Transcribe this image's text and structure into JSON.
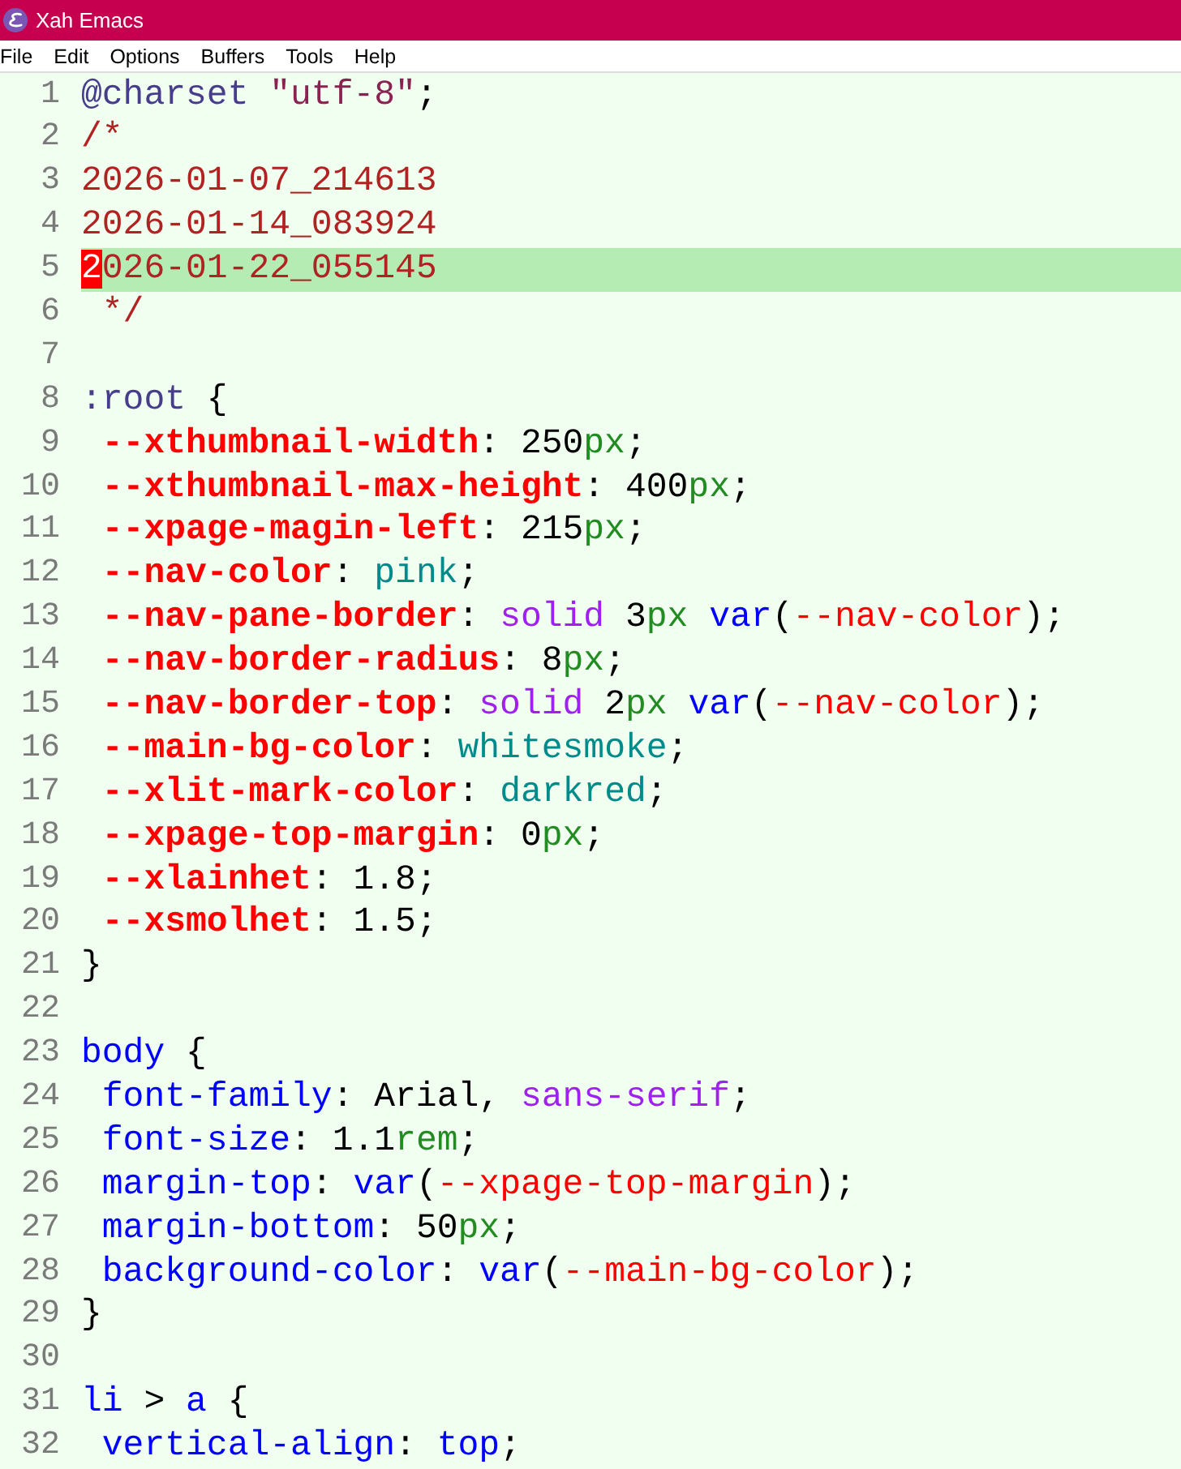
{
  "window": {
    "title": "Xah Emacs"
  },
  "menu_bar": [
    "File",
    "Edit",
    "Options",
    "Buffers",
    "Tools",
    "Help"
  ],
  "editor": {
    "lines": [
      {
        "number": "1",
        "current": false,
        "segments": [
          {
            "text": "@charset",
            "kind": "builtin"
          },
          {
            "text": " \"utf-8\"",
            "kind": "string"
          },
          {
            "text": ";",
            "kind": "plain"
          }
        ]
      },
      {
        "number": "2",
        "current": false,
        "segments": [
          {
            "text": "/*",
            "kind": "comment"
          }
        ]
      },
      {
        "number": "3",
        "current": false,
        "segments": [
          {
            "text": "2026-01-07_214613",
            "kind": "comment"
          }
        ]
      },
      {
        "number": "4",
        "current": false,
        "segments": [
          {
            "text": "2026-01-14_083924",
            "kind": "comment"
          }
        ]
      },
      {
        "number": "5",
        "current": true,
        "segments": [
          {
            "text": "2",
            "kind": "cursor"
          },
          {
            "text": "026-01-22_055145",
            "kind": "comment"
          }
        ]
      },
      {
        "number": "6",
        "current": false,
        "segments": [
          {
            "text": " */",
            "kind": "comment"
          }
        ]
      },
      {
        "number": "7",
        "current": false
      },
      {
        "number": "8",
        "current": false,
        "segments": [
          {
            "text": ":root",
            "kind": "builtin"
          },
          {
            "text": " {",
            "kind": "plain"
          }
        ]
      },
      {
        "number": "9",
        "current": false,
        "segments": [
          {
            "text": " --xthumbnail-width",
            "kind": "custom-property"
          },
          {
            "text": ": 250",
            "kind": "plain"
          },
          {
            "text": "px",
            "kind": "unit"
          },
          {
            "text": ";",
            "kind": "plain"
          }
        ]
      },
      {
        "number": "10",
        "current": false,
        "segments": [
          {
            "text": " --xthumbnail-max-height",
            "kind": "custom-property"
          },
          {
            "text": ": 400",
            "kind": "plain"
          },
          {
            "text": "px",
            "kind": "unit"
          },
          {
            "text": ";",
            "kind": "plain"
          }
        ]
      },
      {
        "number": "11",
        "current": false,
        "segments": [
          {
            "text": " --xpage-magin-left",
            "kind": "custom-property"
          },
          {
            "text": ": 215",
            "kind": "plain"
          },
          {
            "text": "px",
            "kind": "unit"
          },
          {
            "text": ";",
            "kind": "plain"
          }
        ]
      },
      {
        "number": "12",
        "current": false,
        "segments": [
          {
            "text": " --nav-color",
            "kind": "custom-property"
          },
          {
            "text": ": ",
            "kind": "plain"
          },
          {
            "text": "pink",
            "kind": "constant"
          },
          {
            "text": ";",
            "kind": "plain"
          }
        ]
      },
      {
        "number": "13",
        "current": false,
        "segments": [
          {
            "text": " --nav-pane-border",
            "kind": "custom-property"
          },
          {
            "text": ": ",
            "kind": "plain"
          },
          {
            "text": "solid",
            "kind": "keyword"
          },
          {
            "text": " 3",
            "kind": "plain"
          },
          {
            "text": "px",
            "kind": "unit"
          },
          {
            "text": " var",
            "kind": "function"
          },
          {
            "text": "(",
            "kind": "plain"
          },
          {
            "text": "--nav-color",
            "kind": "variable-ref"
          },
          {
            "text": ");",
            "kind": "plain"
          }
        ]
      },
      {
        "number": "14",
        "current": false,
        "segments": [
          {
            "text": " --nav-border-radius",
            "kind": "custom-property"
          },
          {
            "text": ": 8",
            "kind": "plain"
          },
          {
            "text": "px",
            "kind": "unit"
          },
          {
            "text": ";",
            "kind": "plain"
          }
        ]
      },
      {
        "number": "15",
        "current": false,
        "segments": [
          {
            "text": " --nav-border-top",
            "kind": "custom-property"
          },
          {
            "text": ": ",
            "kind": "plain"
          },
          {
            "text": "solid",
            "kind": "keyword"
          },
          {
            "text": " 2",
            "kind": "plain"
          },
          {
            "text": "px",
            "kind": "unit"
          },
          {
            "text": " var",
            "kind": "function"
          },
          {
            "text": "(",
            "kind": "plain"
          },
          {
            "text": "--nav-color",
            "kind": "variable-ref"
          },
          {
            "text": ");",
            "kind": "plain"
          }
        ]
      },
      {
        "number": "16",
        "current": false,
        "segments": [
          {
            "text": " --main-bg-color",
            "kind": "custom-property"
          },
          {
            "text": ": ",
            "kind": "plain"
          },
          {
            "text": "whitesmoke",
            "kind": "constant"
          },
          {
            "text": ";",
            "kind": "plain"
          }
        ]
      },
      {
        "number": "17",
        "current": false,
        "segments": [
          {
            "text": " --xlit-mark-color",
            "kind": "custom-property"
          },
          {
            "text": ": ",
            "kind": "plain"
          },
          {
            "text": "darkred",
            "kind": "constant"
          },
          {
            "text": ";",
            "kind": "plain"
          }
        ]
      },
      {
        "number": "18",
        "current": false,
        "segments": [
          {
            "text": " --xpage-top-margin",
            "kind": "custom-property"
          },
          {
            "text": ": 0",
            "kind": "plain"
          },
          {
            "text": "px",
            "kind": "unit"
          },
          {
            "text": ";",
            "kind": "plain"
          }
        ]
      },
      {
        "number": "19",
        "current": false,
        "segments": [
          {
            "text": " --xlainhet",
            "kind": "custom-property"
          },
          {
            "text": ": 1.8;",
            "kind": "plain"
          }
        ]
      },
      {
        "number": "20",
        "current": false,
        "segments": [
          {
            "text": " --xsmolhet",
            "kind": "custom-property"
          },
          {
            "text": ": 1.5;",
            "kind": "plain"
          }
        ]
      },
      {
        "number": "21",
        "current": false,
        "segments": [
          {
            "text": "}",
            "kind": "plain"
          }
        ]
      },
      {
        "number": "22",
        "current": false
      },
      {
        "number": "23",
        "current": false,
        "segments": [
          {
            "text": "body",
            "kind": "selector"
          },
          {
            "text": " {",
            "kind": "plain"
          }
        ]
      },
      {
        "number": "24",
        "current": false,
        "segments": [
          {
            "text": " font-family",
            "kind": "property"
          },
          {
            "text": ": Arial, ",
            "kind": "plain"
          },
          {
            "text": "sans-serif",
            "kind": "keyword"
          },
          {
            "text": ";",
            "kind": "plain"
          }
        ]
      },
      {
        "number": "25",
        "current": false,
        "segments": [
          {
            "text": " font-size",
            "kind": "property"
          },
          {
            "text": ": 1.1",
            "kind": "plain"
          },
          {
            "text": "rem",
            "kind": "unit"
          },
          {
            "text": ";",
            "kind": "plain"
          }
        ]
      },
      {
        "number": "26",
        "current": false,
        "segments": [
          {
            "text": " margin-top",
            "kind": "property"
          },
          {
            "text": ": ",
            "kind": "plain"
          },
          {
            "text": "var",
            "kind": "function"
          },
          {
            "text": "(",
            "kind": "plain"
          },
          {
            "text": "--xpage-top-margin",
            "kind": "variable-ref"
          },
          {
            "text": ");",
            "kind": "plain"
          }
        ]
      },
      {
        "number": "27",
        "current": false,
        "segments": [
          {
            "text": " margin-bottom",
            "kind": "property"
          },
          {
            "text": ": 50",
            "kind": "plain"
          },
          {
            "text": "px",
            "kind": "unit"
          },
          {
            "text": ";",
            "kind": "plain"
          }
        ]
      },
      {
        "number": "28",
        "current": false,
        "segments": [
          {
            "text": " background-color",
            "kind": "property"
          },
          {
            "text": ": ",
            "kind": "plain"
          },
          {
            "text": "var",
            "kind": "function"
          },
          {
            "text": "(",
            "kind": "plain"
          },
          {
            "text": "--main-bg-color",
            "kind": "variable-ref"
          },
          {
            "text": ");",
            "kind": "plain"
          }
        ]
      },
      {
        "number": "29",
        "current": false,
        "segments": [
          {
            "text": "}",
            "kind": "plain"
          }
        ]
      },
      {
        "number": "30",
        "current": false
      },
      {
        "number": "31",
        "current": false,
        "segments": [
          {
            "text": "li",
            "kind": "selector"
          },
          {
            "text": " > ",
            "kind": "plain"
          },
          {
            "text": "a",
            "kind": "selector"
          },
          {
            "text": " {",
            "kind": "plain"
          }
        ]
      },
      {
        "number": "32",
        "current": false,
        "segments": [
          {
            "text": " vertical-align",
            "kind": "property"
          },
          {
            "text": ": ",
            "kind": "plain"
          },
          {
            "text": "top",
            "kind": "value-keyword"
          },
          {
            "text": ";",
            "kind": "plain"
          }
        ]
      }
    ]
  }
}
